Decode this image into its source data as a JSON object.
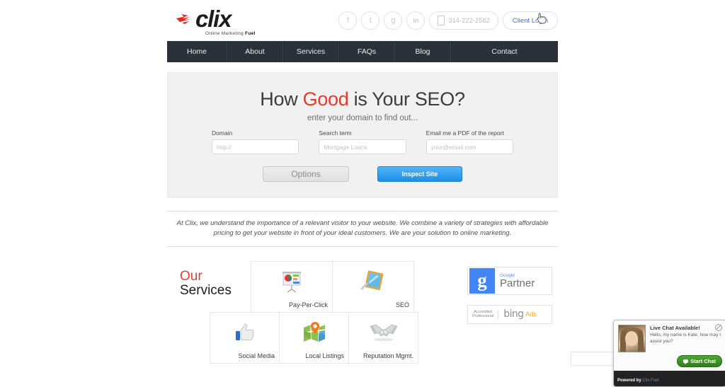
{
  "header": {
    "logo": {
      "name": "clix",
      "tagline_1": "Online Marketing ",
      "tagline_2": "Fuel"
    },
    "social": [
      {
        "name": "facebook-icon",
        "glyph": "f"
      },
      {
        "name": "twitter-icon",
        "glyph": "t"
      },
      {
        "name": "google-plus-icon",
        "glyph": "g"
      },
      {
        "name": "linkedin-icon",
        "glyph": "in"
      }
    ],
    "phone": "314-222-2582",
    "client_login": "Client Login"
  },
  "nav": {
    "items": [
      "Home",
      "About",
      "Services",
      "FAQs",
      "Blog",
      "Contact"
    ]
  },
  "hero": {
    "title_before": "How ",
    "title_accent": "Good",
    "title_after": " is Your SEO?",
    "subtitle": "enter your domain to find out...",
    "fields": [
      {
        "label": "Domain",
        "placeholder": "http://",
        "value": ""
      },
      {
        "label": "Search term",
        "placeholder": "Mortgage Loans",
        "value": ""
      },
      {
        "label": "Email me a PDF of the report",
        "placeholder": "your@email.com",
        "value": ""
      }
    ],
    "options_button": "Options",
    "inspect_button": "Inspect Site"
  },
  "blurb": "At Clix, we understand the importance of a relevant visitor to your website. We combine a variety of strategies with affordable pricing to get your website in front of your ideal customers. We are your solution to online marketing.",
  "services": {
    "title_accent": "Our",
    "title_main": "Services",
    "tiles": [
      {
        "label": "Pay-Per-Click",
        "icon": "presentation-chart-icon"
      },
      {
        "label": "SEO",
        "icon": "magnifier-panel-icon"
      },
      {
        "label": "Social Media",
        "icon": "thumbs-up-icon"
      },
      {
        "label": "Local Listings",
        "icon": "map-pin-icon"
      },
      {
        "label": "Reputation Mgmt.",
        "icon": "handshake-icon"
      }
    ]
  },
  "badges": {
    "google": {
      "letter": "g",
      "line1": "Google",
      "line2": "Partner"
    },
    "bing": {
      "accredited_1": "Accredited",
      "accredited_2": "Professional",
      "brand": "bing",
      "ads": "Ads"
    }
  },
  "chat": {
    "heading": "Live Chat Available!",
    "message": "Hello, my name is Kate, how may I assist you?",
    "start_button": "Start Chat",
    "powered_by": "Powered by ",
    "powered_brand": "Clix Fuel"
  },
  "colors": {
    "accent_red": "#e23b2e",
    "nav_bg": "#2b3138",
    "button_blue": "#1b8ee8",
    "chat_green": "#2f7d1c",
    "google_blue": "#4285f4",
    "bing_orange": "#f0a62c"
  }
}
